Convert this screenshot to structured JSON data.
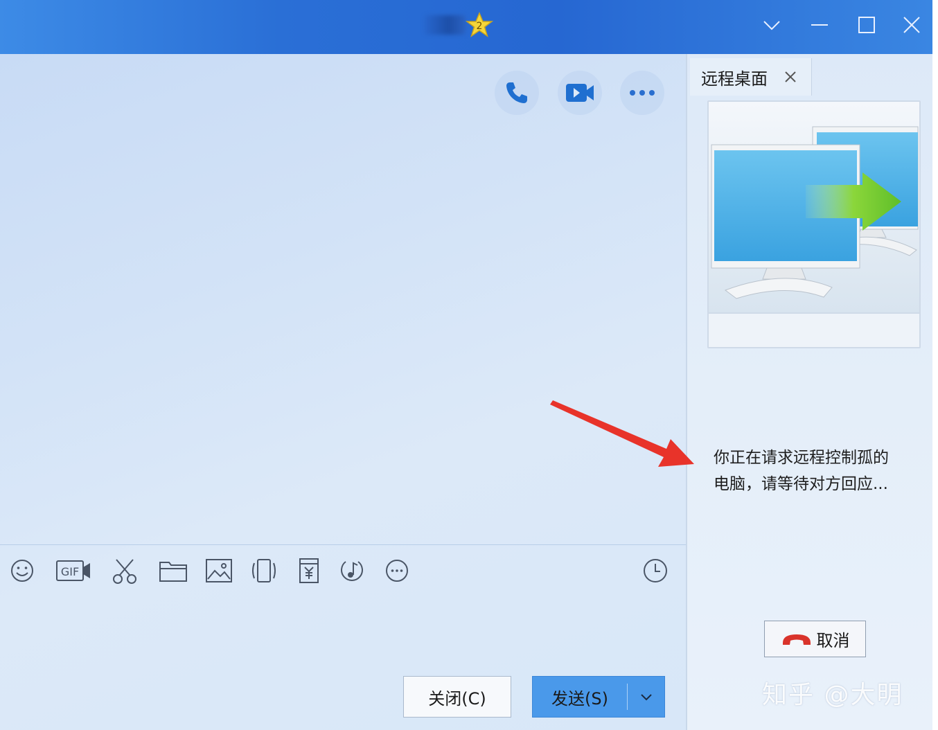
{
  "titlebar": {
    "window_controls": [
      {
        "name": "chevron-down-icon"
      },
      {
        "name": "minimize-icon"
      },
      {
        "name": "maximize-icon"
      },
      {
        "name": "close-icon"
      }
    ]
  },
  "chat": {
    "top_actions": [
      "phone-icon",
      "video-icon",
      "more-icon"
    ],
    "toolbar": [
      "emoji-icon",
      "gif-icon",
      "scissors-icon",
      "folder-icon",
      "image-icon",
      "shake-icon",
      "red-packet-icon",
      "music-icon",
      "more-circle-icon",
      "history-clock-icon"
    ],
    "close_label": "关闭(C)",
    "send_label": "发送(S)"
  },
  "panel": {
    "tab_label": "远程桌面",
    "status_line1": "你正在请求远程控制孤的",
    "status_line2": "电脑，请等待对方回应...",
    "cancel_label": "取消"
  },
  "watermark": "知乎 @大明",
  "colors": {
    "titlebar": "#2667d2",
    "send_button": "#4a99ea",
    "annotation_arrow": "#e8332a",
    "hangup": "#d9332b"
  }
}
